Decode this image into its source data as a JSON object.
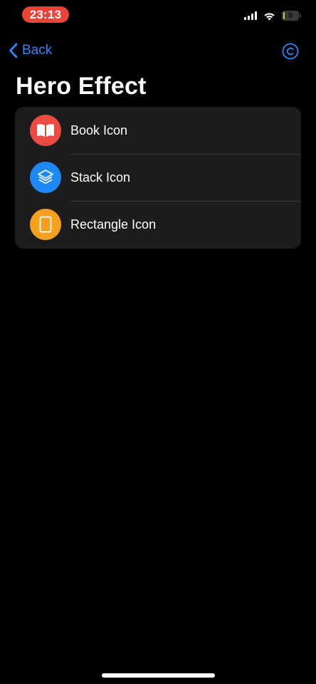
{
  "status_bar": {
    "time": "23:13",
    "battery_level": "9",
    "time_pill_color": "#eb4338",
    "battery_color": "#d7c542",
    "signal_icon": "cellular-signal-icon",
    "wifi_icon": "wifi-icon",
    "battery_icon": "battery-icon"
  },
  "nav": {
    "back_label": "Back",
    "back_icon": "chevron-left-icon",
    "trailing_icon": "copyright-icon",
    "accent_color": "#2a88ff"
  },
  "page": {
    "title": "Hero Effect"
  },
  "list": {
    "items": [
      {
        "label": "Book Icon",
        "icon": "book-icon",
        "color": "#eb4b41"
      },
      {
        "label": "Stack Icon",
        "icon": "stack-icon",
        "color": "#1e88f5"
      },
      {
        "label": "Rectangle Icon",
        "icon": "rectangle-icon",
        "color": "#f5a01e"
      }
    ]
  }
}
